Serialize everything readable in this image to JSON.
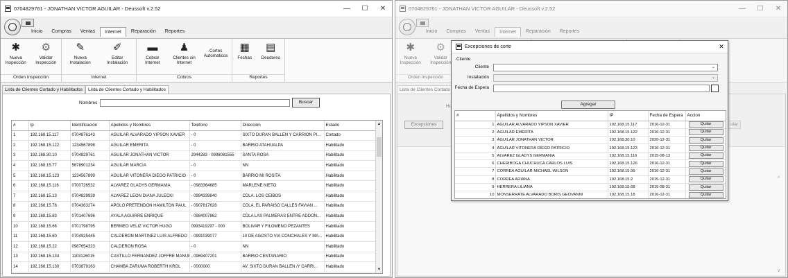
{
  "app": {
    "title": "0704829761 - JONATHAN VICTOR AGUILAR -  Deussoft v.2.52",
    "tabs": [
      "Inicio",
      "Compras",
      "Ventas",
      "Internet",
      "Reparación",
      "Reportes"
    ],
    "active_tab": "Internet"
  },
  "window_controls": {
    "minimize": "—",
    "maximize": "☐",
    "close": "✕"
  },
  "ribbon": {
    "groups": [
      {
        "label": "Orden Inspección",
        "buttons": [
          {
            "label": "Nueva Inspección",
            "icon": "asterisk-icon"
          },
          {
            "label": "Validar Inspección",
            "icon": "gear-icon"
          }
        ]
      },
      {
        "label": "Internet",
        "buttons": [
          {
            "label": "Nueva Instalacion",
            "icon": "tools-icon"
          },
          {
            "label": "Editar Instalación",
            "icon": "tools-edit-icon"
          }
        ]
      },
      {
        "label": "Cobros",
        "buttons": [
          {
            "label": "Cobrar Internet",
            "icon": "money-icon"
          },
          {
            "label": "Clientes sin Internet",
            "icon": "user-x-icon"
          },
          {
            "label": "Cortes Automaticos",
            "icon": "none"
          }
        ]
      },
      {
        "label": "Reportes",
        "buttons": [
          {
            "label": "Fechas",
            "icon": "calendar-icon"
          },
          {
            "label": "Deudores",
            "icon": "chart-icon"
          }
        ]
      }
    ]
  },
  "doc_tabs": [
    "Lista de Clientes Cortado y Habilitados",
    "Lista de Clientes Cortado y Habilitados"
  ],
  "search": {
    "label": "Nombres",
    "value": "",
    "button": "Buscar"
  },
  "clients_table": {
    "columns": [
      "#",
      "Ip",
      "Identificación",
      "Apellidos y Nombres",
      "Teléfono",
      "Dirección",
      "Estado"
    ],
    "rows": [
      [
        "1",
        "192.168.15.117",
        "0704876143",
        "AGUILAR ALVARADO YIPSON XAVIER",
        "- 0",
        "SIXTO DURAN BALLEN Y CARRION PI...",
        "Cortado"
      ],
      [
        "2",
        "192.168.15.122",
        "1234567898",
        "AGUILAR EMERITA",
        "- 0",
        "BARRIO ATAHUALPA",
        "Habilitado"
      ],
      [
        "3",
        "192.168.30.10",
        "0704829761",
        "AGUILAR JONATHAN VICTOR",
        "2944283 - 0998081555",
        "SANTA ROSA",
        "Habilitado"
      ],
      [
        "4",
        "192.168.15.77",
        "5678901234",
        "AGUILAR MARCIA",
        "- 0",
        "NN",
        "Habilitado"
      ],
      [
        "5",
        "192.168.15.123",
        "1234567899",
        "AGUILAR VITONERA DIEGO PATRICIO",
        "- 0",
        "BARRIO MI ROSITA",
        "Habilitado"
      ],
      [
        "6",
        "192.168.15.116",
        "0700726532",
        "ALVAREZ GLADYS GERMANIA",
        "- 0983364685",
        "MARLENE NIETO",
        "Habilitado"
      ],
      [
        "7",
        "192.168.15.13",
        "0704829939",
        "ALVAREZ LEON DIANA JULECKI",
        "- 0994339840",
        "CDLA.  LOS CEIBOS",
        "Habilitado"
      ],
      [
        "8",
        "192.168.15.78",
        "0704363274",
        "APOLO PRETENDON HAMILTON PAUL",
        "- 0907817628",
        "CDLA. EL PARAISO  CALLES FAVIAN ...",
        "Habilitado"
      ],
      [
        "9",
        "192.168.15.83",
        "0701407696",
        "AYALA AGUIRRE ENRIQUE",
        "- 0984007862",
        "CDLA LAS PALMERAS  ENTRE ADDON...",
        "Habilitado"
      ],
      [
        "10",
        "192.168.15.66",
        "0701798795",
        "BERMEO VELIZ VICTOR HUGO",
        "0993419297 - 000",
        "BOLIVAR Y FILOMENO PEZANTES",
        "Habilitado"
      ],
      [
        "11",
        "192.168.15.60",
        "0704925445",
        "CALDERON MARTINEZ LUIS ALFREDO",
        "- 0991039077",
        "10 DE AGOSTO VIA CONCHALES Y MA...",
        "Habilitado"
      ],
      [
        "12",
        "192.168.15.22",
        "0987654323",
        "CALDERON ROSA",
        "- 0",
        "NN",
        "Habilitado"
      ],
      [
        "13",
        "192.168.15.134",
        "1103126015",
        "CASTILLO FERNANDEZ JOFFRE MANUEL",
        "- 0969407201",
        "BARRIO CENTANARIO",
        "Habilitado"
      ],
      [
        "14",
        "192.168.15.130",
        "0703879163",
        "CHAMBA ZARUMA ROBERTH KROL",
        "- 0000000",
        "AV. SIXTO DURAN BALLEN /Y CARRI...",
        "Habilitado"
      ]
    ]
  },
  "background_right": {
    "excepciones_button": "Excepciones",
    "partial_label_1": "Ho",
    "ghost_button": "ular"
  },
  "dialog": {
    "title": "Excepciones de corte",
    "close": "✕",
    "group_label": "Cliente",
    "fields": [
      {
        "label": "Cliente",
        "value": ""
      },
      {
        "label": "Instalación",
        "value": ""
      },
      {
        "label": "Fecha de Espera",
        "value": ""
      }
    ],
    "add_button": "Agregar",
    "table": {
      "columns": [
        "#",
        "Apellidos y Nombres",
        "IP",
        "Fecha de Espera",
        "Accion"
      ],
      "rows": [
        [
          "1",
          "AGUILAR ALVARADO YIPSON XAVIER",
          "192.168.15.117",
          "2016-12-31",
          "Quitar"
        ],
        [
          "2",
          "AGUILAR EMERITA",
          "192.168.15.122",
          "2016-12-31",
          "Quitar"
        ],
        [
          "3",
          "AGUILAR JONATHAN VICTOR",
          "192.168.30.10",
          "2020-12-31",
          "Quitar"
        ],
        [
          "4",
          "AGUILAR VITONERA DIEGO PATRICIO",
          "192.168.15.123",
          "2016-12-31",
          "Quitar"
        ],
        [
          "5",
          "ALVAREZ GLADYS GERMANIA",
          "192.168.15.116",
          "2015-08-13",
          "Quitar"
        ],
        [
          "6",
          "CHERIBOGA CHUCHUCA CARLOS LUIS",
          "192.168.15.126",
          "2016-12-31",
          "Quitar"
        ],
        [
          "7",
          "CORREA AGUILAR MICHAEL WILSON",
          "192.168.15.99",
          "2016-12-31",
          "Quitar"
        ],
        [
          "8",
          "CORREA ARIANA",
          "192.168.15.2",
          "2015-12-31",
          "Quitar"
        ],
        [
          "9",
          "HERRERA LILIANA",
          "192.168.15.68",
          "2015-08-31",
          "Quitar"
        ],
        [
          "10",
          "MONSERRATE ALVARADO BORIS GEOVANNI",
          "192.168.15.18",
          "2016-12-31",
          "Quitar"
        ]
      ]
    }
  }
}
